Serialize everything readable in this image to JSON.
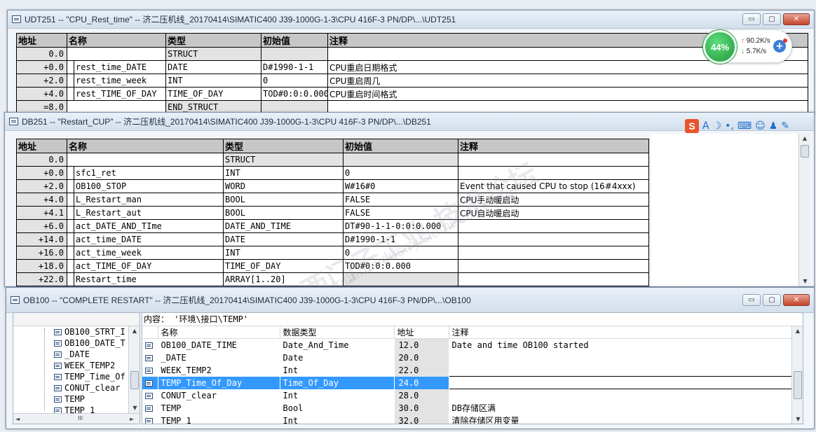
{
  "udt": {
    "title": "UDT251 -- \"CPU_Rest_time\" -- 济二压机线_20170414\\SIMATIC400 J39-1000G-1-3\\CPU 416F-3 PN/DP\\...\\UDT251",
    "headers": [
      "地址",
      "名称",
      "类型",
      "初始值",
      "注释"
    ],
    "rows": [
      {
        "addr": "0.0",
        "name": "",
        "type": "STRUCT",
        "init": "",
        "comment": ""
      },
      {
        "addr": "+0.0",
        "name": "rest_time_DATE",
        "type": "DATE",
        "init": "D#1990-1-1",
        "comment": "CPU重启日期格式"
      },
      {
        "addr": "+2.0",
        "name": "rest_time_week",
        "type": "INT",
        "init": "0",
        "comment": "CPU重启周几"
      },
      {
        "addr": "+4.0",
        "name": "rest_TIME_OF_DAY",
        "type": "TIME_OF_DAY",
        "init": "TOD#0:0:0.000",
        "comment": "CPU重启时间格式"
      },
      {
        "addr": "=8.0",
        "name": "",
        "type": "END_STRUCT",
        "init": "",
        "comment": ""
      }
    ]
  },
  "db": {
    "title": "DB251 -- \"Restart_CUP\" -- 济二压机线_20170414\\SIMATIC400 J39-1000G-1-3\\CPU 416F-3 PN/DP\\...\\DB251",
    "headers": [
      "地址",
      "名称",
      "类型",
      "初始值",
      "注释"
    ],
    "rows": [
      {
        "addr": "0.0",
        "name": "",
        "type": "STRUCT",
        "init": "",
        "comment": ""
      },
      {
        "addr": "+0.0",
        "name": "sfc1_ret",
        "type": "INT",
        "init": "0",
        "comment": ""
      },
      {
        "addr": "+2.0",
        "name": "OB100_STOP",
        "type": "WORD",
        "init": "W#16#0",
        "comment": "Event that caused CPU to stop (16#4xxx)"
      },
      {
        "addr": "+4.0",
        "name": "L_Restart_man",
        "type": "BOOL",
        "init": "FALSE",
        "comment": "CPU手动暖启动"
      },
      {
        "addr": "+4.1",
        "name": "L_Restart_aut",
        "type": "BOOL",
        "init": "FALSE",
        "comment": "CPU自动暖启动"
      },
      {
        "addr": "+6.0",
        "name": "act_DATE_AND_TIme",
        "type": "DATE_AND_TIME",
        "init": "DT#90-1-1-0:0:0.000",
        "comment": ""
      },
      {
        "addr": "+14.0",
        "name": "act_time_DATE",
        "type": "DATE",
        "init": "D#1990-1-1",
        "comment": ""
      },
      {
        "addr": "+16.0",
        "name": "act_time_week",
        "type": "INT",
        "init": "0",
        "comment": ""
      },
      {
        "addr": "+18.0",
        "name": "act_TIME_OF_DAY",
        "type": "TIME_OF_DAY",
        "init": "TOD#0:0:0.000",
        "comment": ""
      },
      {
        "addr": "+22.0",
        "name": "Restart_time",
        "type": "ARRAY[1..20]",
        "init": "",
        "comment": ""
      }
    ]
  },
  "ob": {
    "title": "OB100 -- \"COMPLETE RESTART\" -- 济二压机线_20170414\\SIMATIC400 J39-1000G-1-3\\CPU 416F-3 PN/DP\\...\\OB100",
    "content_label": "内容：  '环境\\接口\\TEMP'",
    "tree_items": [
      "OB100_STRT_I",
      "OB100_DATE_T",
      "_DATE",
      "WEEK_TEMP2",
      "TEMP_Time_Of",
      "CONUT_clear",
      "TEMP",
      "TEMP_1"
    ],
    "headers": [
      "名称",
      "数据类型",
      "地址",
      "注释"
    ],
    "rows": [
      {
        "name": "OB100_DATE_TIME",
        "type": "Date_And_Time",
        "addr": "12.0",
        "comment": "Date and time OB100 started"
      },
      {
        "name": "_DATE",
        "type": "Date",
        "addr": "20.0",
        "comment": ""
      },
      {
        "name": "WEEK_TEMP2",
        "type": "Int",
        "addr": "22.0",
        "comment": ""
      },
      {
        "name": "TEMP_Time_Of_Day",
        "type": "Time_Of_Day",
        "addr": "24.0",
        "comment": ""
      },
      {
        "name": "CONUT_clear",
        "type": "Int",
        "addr": "28.0",
        "comment": ""
      },
      {
        "name": "TEMP",
        "type": "Bool",
        "addr": "30.0",
        "comment": "DB存储区满"
      },
      {
        "name": "TEMP_1",
        "type": "Int",
        "addr": "32.0",
        "comment": "清除存储区用变量"
      }
    ],
    "selected_row": 3
  },
  "network": {
    "percent": "44%",
    "up": "90.2K/s",
    "down": "5.7K/s"
  },
  "window_buttons": {
    "min": "▭",
    "max": "▢",
    "close": "✕"
  },
  "scroll": {
    "up": "▲",
    "down": "▼",
    "left": "◄",
    "right": "►",
    "grip": "III"
  },
  "ime": {
    "logo": "S",
    "a": "A",
    "moon": "☽"
  }
}
